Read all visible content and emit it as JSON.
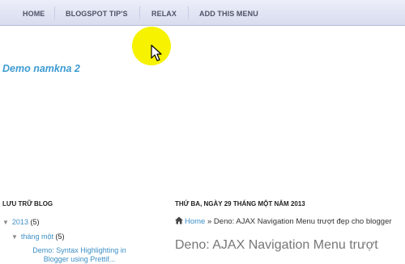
{
  "nav": {
    "items": [
      {
        "label": "HOME"
      },
      {
        "label": "BLOGSPOT TIP'S"
      },
      {
        "label": "RELAX"
      },
      {
        "label": "ADD THIS MENU"
      }
    ]
  },
  "blog": {
    "title": "Demo namkna 2"
  },
  "sidebar": {
    "heading": "LƯU TRỮ BLOG",
    "year": {
      "label": "2013",
      "count": "(5)"
    },
    "month": {
      "label": "tháng một",
      "count": "(5)"
    },
    "post_line1": "Demo: Syntax Highlighting in",
    "post_line2": "Blogger using Prettif..."
  },
  "main": {
    "date": "THỨ BA, NGÀY 29 THÁNG MỘT NĂM 2013",
    "breadcrumb": {
      "home": "Home",
      "separator": "»",
      "current": "Deno: AJAX Navigation Menu trượt đẹp cho blogger"
    },
    "post_title": "Deno: AJAX Navigation Menu trượt"
  },
  "colors": {
    "link": "#3b8fc5",
    "title": "#3d9bd1",
    "highlight": "#f6f200"
  }
}
